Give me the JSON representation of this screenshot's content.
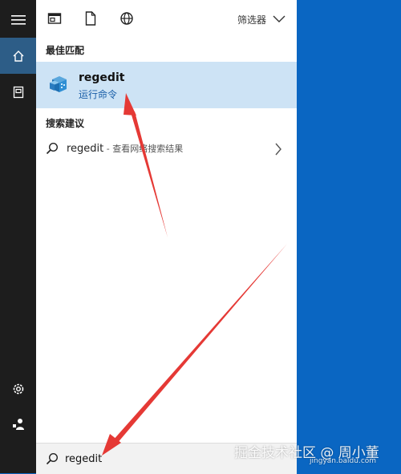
{
  "topbar": {
    "filter_label": "筛选器"
  },
  "sections": {
    "best_match": "最佳匹配",
    "suggestions": "搜索建议"
  },
  "best_match": {
    "title": "regedit",
    "subtitle": "运行命令"
  },
  "suggestion": {
    "query": "regedit",
    "hint": " - 查看网络搜索结果"
  },
  "search": {
    "value": "regedit"
  },
  "watermark": {
    "text": "掘金技术社区 @ 周小董",
    "sub": "jingyan.baidu.com"
  },
  "colors": {
    "taskbar_blue": "#0a66c2",
    "rail": "#1d1d1d",
    "active_rail": "#2d5d87",
    "highlight": "#cde3f5",
    "accent_text": "#1a5fa8",
    "annotation_red": "#e53935"
  },
  "icons": {
    "rail": [
      "hamburger-icon",
      "home-icon",
      "documents-icon",
      "settings-icon",
      "user-icon"
    ],
    "topbar": [
      "apps-icon",
      "document-icon",
      "web-icon",
      "chevron-down-icon"
    ],
    "best_match": "registry-editor-icon",
    "suggestion": [
      "search-icon",
      "chevron-right-icon"
    ],
    "searchbox": "search-icon"
  }
}
